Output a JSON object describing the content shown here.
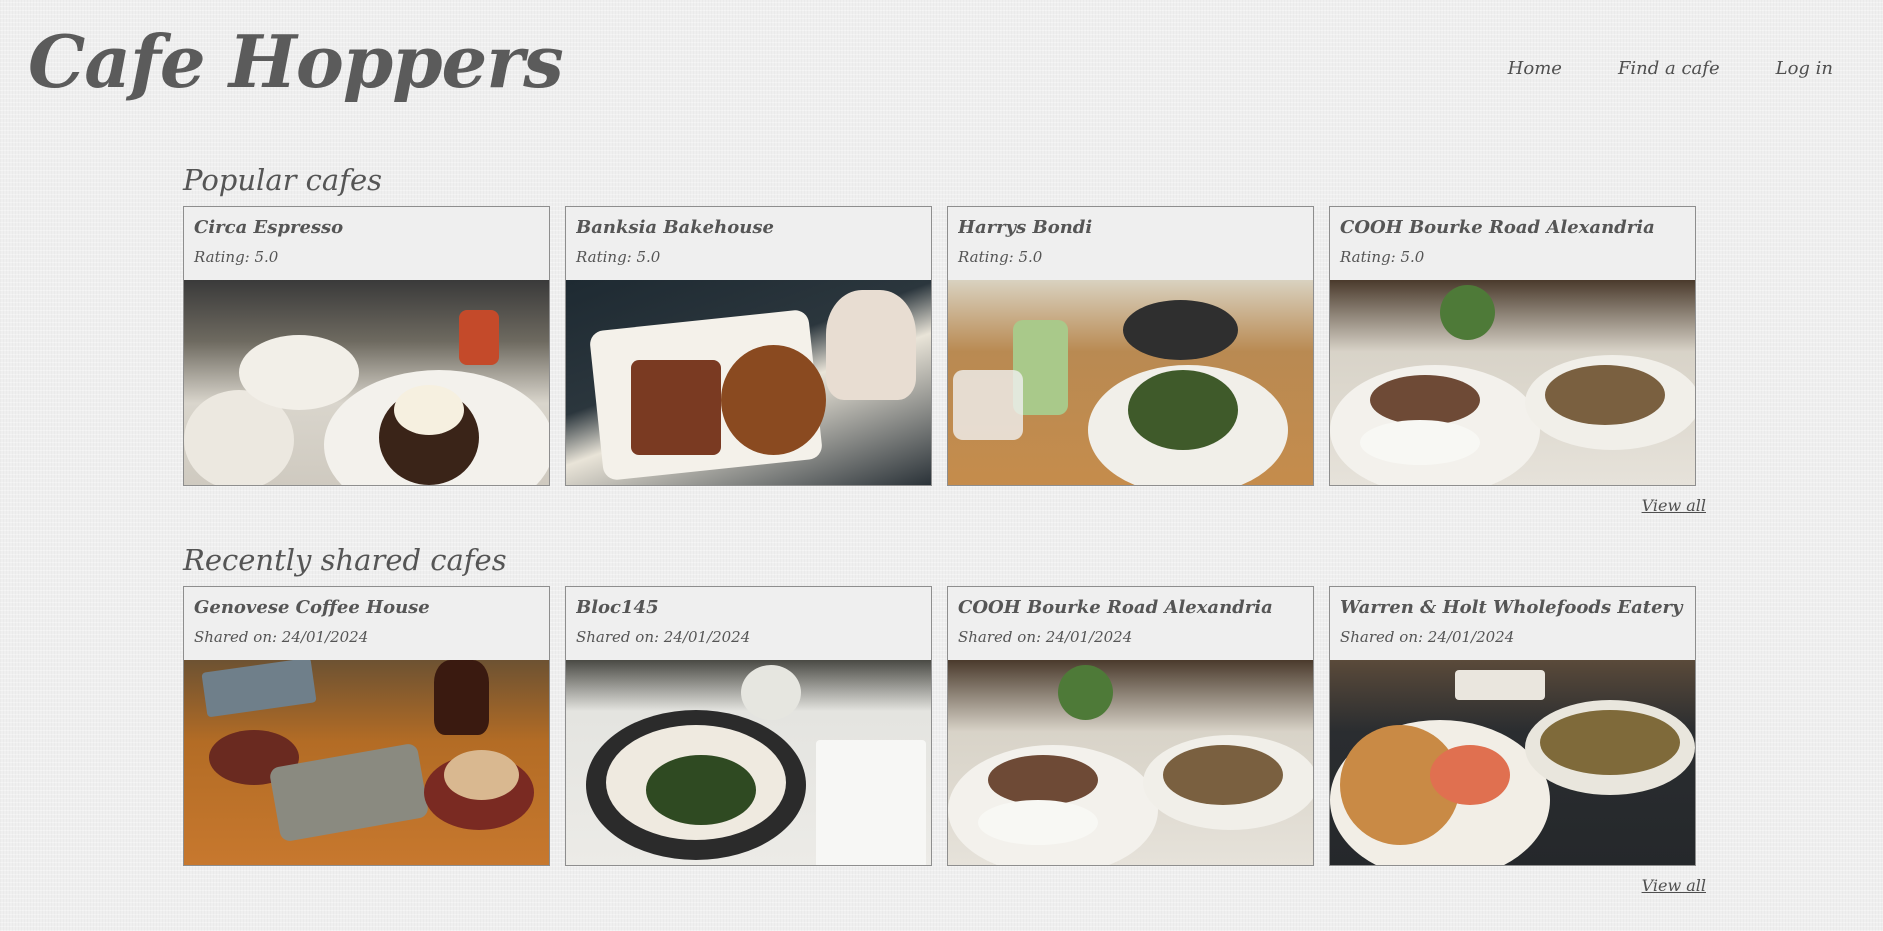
{
  "site": {
    "title": "Cafe Hoppers"
  },
  "nav": {
    "items": [
      {
        "label": "Home"
      },
      {
        "label": "Find a cafe"
      },
      {
        "label": "Log in"
      }
    ]
  },
  "popular": {
    "heading": "Popular cafes",
    "view_all": "View all",
    "cards": [
      {
        "name": "Circa Espresso",
        "meta": "Rating: 5.0"
      },
      {
        "name": "Banksia Bakehouse",
        "meta": "Rating: 5.0"
      },
      {
        "name": "Harrys Bondi",
        "meta": "Rating: 5.0"
      },
      {
        "name": "COOH Bourke Road Alexandria",
        "meta": "Rating: 5.0"
      }
    ]
  },
  "recent": {
    "heading": "Recently shared cafes",
    "view_all": "View all",
    "cards": [
      {
        "name": "Genovese Coffee House",
        "meta": "Shared on: 24/01/2024"
      },
      {
        "name": "Bloc145",
        "meta": "Shared on: 24/01/2024"
      },
      {
        "name": "COOH Bourke Road Alexandria",
        "meta": "Shared on: 24/01/2024"
      },
      {
        "name": "Warren & Holt Wholefoods Eatery",
        "meta": "Shared on: 24/01/2024"
      }
    ]
  },
  "colors": {
    "background": "#efefef",
    "text": "#555555",
    "border": "#8e8e8e"
  }
}
